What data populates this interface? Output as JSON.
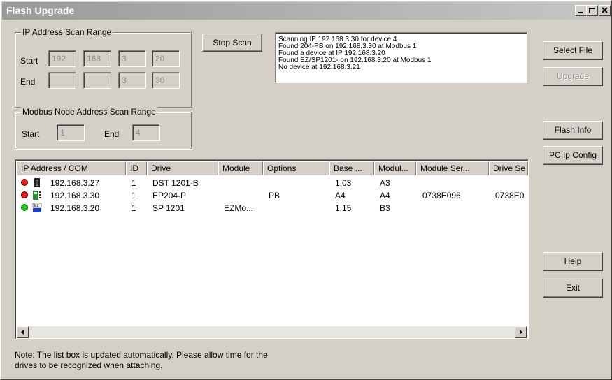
{
  "window": {
    "title": "Flash Upgrade"
  },
  "ip_scan": {
    "legend": "IP Address Scan Range",
    "start_label": "Start",
    "end_label": "End",
    "start": [
      "192",
      "168",
      "3",
      "20"
    ],
    "end": [
      "",
      "",
      "3",
      "30"
    ]
  },
  "modbus_scan": {
    "legend": "Modbus Node Address Scan Range",
    "start_label": "Start",
    "start_value": "1",
    "end_label": "End",
    "end_value": "4"
  },
  "buttons": {
    "stop_scan": "Stop Scan",
    "select_file": "Select File",
    "upgrade": "Upgrade",
    "flash_info": "Flash Info",
    "pc_ip_config": "PC Ip Config",
    "help": "Help",
    "exit": "Exit"
  },
  "log": [
    "Scanning IP 192.168.3.30 for device 4",
    "Found 204-PB on 192.168.3.30 at Modbus 1",
    "Found a device at IP 192.168.3.20",
    "Found EZ/SP1201- on 192.168.3.20 at Modbus 1",
    "No device at 192.168.3.21"
  ],
  "table": {
    "columns": [
      "IP Address / COM",
      "ID",
      "Drive",
      "Module",
      "Options",
      "Base ...",
      "Modul...",
      "Module Ser...",
      "Drive Se"
    ],
    "rows": [
      {
        "status": "#e02020",
        "icon": "dst-drive-icon",
        "ip": "192.168.3.27",
        "id": "1",
        "drive": "DST 1201-B",
        "module": "",
        "options": "",
        "base": "1.03",
        "modul": "A3",
        "module_ser": "",
        "drive_ser": ""
      },
      {
        "status": "#e02020",
        "icon": "ep-drive-icon",
        "ip": "192.168.3.30",
        "id": "1",
        "drive": "EP204-P",
        "module": "",
        "options": "PB",
        "base": "A4",
        "modul": "A4",
        "module_ser": "0738E096",
        "drive_ser": "0738E0"
      },
      {
        "status": "#20c020",
        "icon": "ez-drive-icon",
        "ip": "192.168.3.20",
        "id": "1",
        "drive": "SP 1201",
        "module": "EZMo...",
        "options": "",
        "base": "1.15",
        "modul": "B3",
        "module_ser": "",
        "drive_ser": ""
      }
    ]
  },
  "note": [
    "Note: The list box is updated automatically.  Please allow time for the",
    "drives to be recognized when attaching."
  ]
}
